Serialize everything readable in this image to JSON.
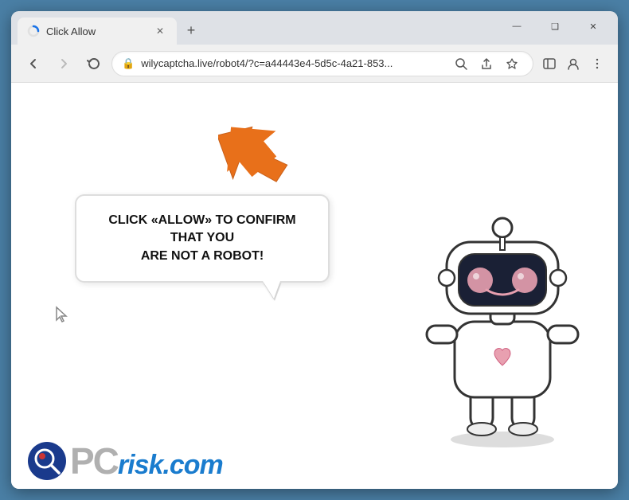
{
  "browser": {
    "tab": {
      "title": "Click Allow",
      "favicon": "loading"
    },
    "address": "wilycaptcha.live/robot4/?c=a44443e4-5d5c-4a21-853...",
    "new_tab_label": "+",
    "window_controls": {
      "minimize": "—",
      "maximize": "❑",
      "close": "✕"
    },
    "nav": {
      "back": "←",
      "forward": "→",
      "reload": "✕"
    }
  },
  "page": {
    "bubble_line1": "CLICK «ALLOW» TO CONFIRM THAT YOU",
    "bubble_line2": "ARE NOT A ROBOT!"
  },
  "footer": {
    "pc_text": "PC",
    "risk_text": "risk.com"
  },
  "icons": {
    "lock": "🔒",
    "search": "🔍",
    "share": "⬆",
    "star": "☆",
    "sidebar": "▭",
    "profile": "👤",
    "menu": "⋮"
  }
}
